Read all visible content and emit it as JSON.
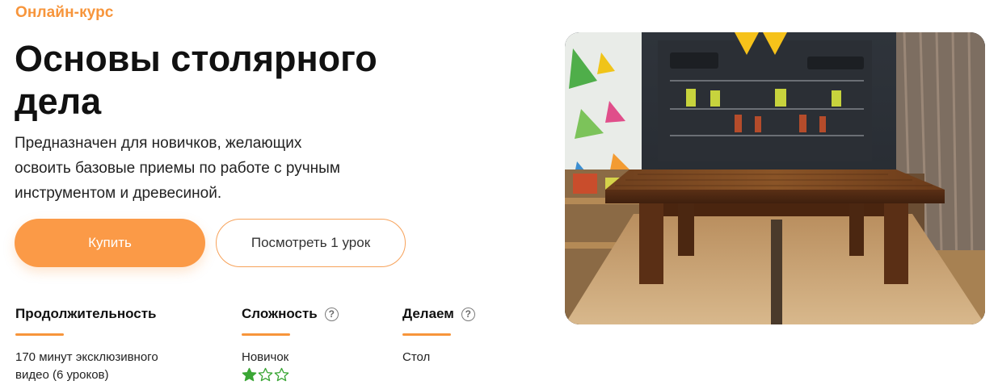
{
  "course": {
    "eyebrow": "Онлайн-курс",
    "title": "Основы столярного дела",
    "description": "Предназначен для новичков, желающих освоить базовые приемы по работе с ручным инструментом и древесиной."
  },
  "buttons": {
    "buy_label": "Купить",
    "preview_label": "Посмотреть 1 урок"
  },
  "stats": {
    "duration": {
      "title": "Продолжительность",
      "value": "170 минут эксклюзивного видео (6 уроков)"
    },
    "difficulty": {
      "title": "Сложность",
      "help": "?",
      "value": "Новичок",
      "rating": 1,
      "rating_max": 3
    },
    "project": {
      "title": "Делаем",
      "help": "?",
      "value": "Стол"
    }
  },
  "image": {
    "icon": "workshop-table-photo"
  },
  "colors": {
    "accent": "#f7953b",
    "button": "#fb9a47",
    "star": "#3aa635"
  }
}
